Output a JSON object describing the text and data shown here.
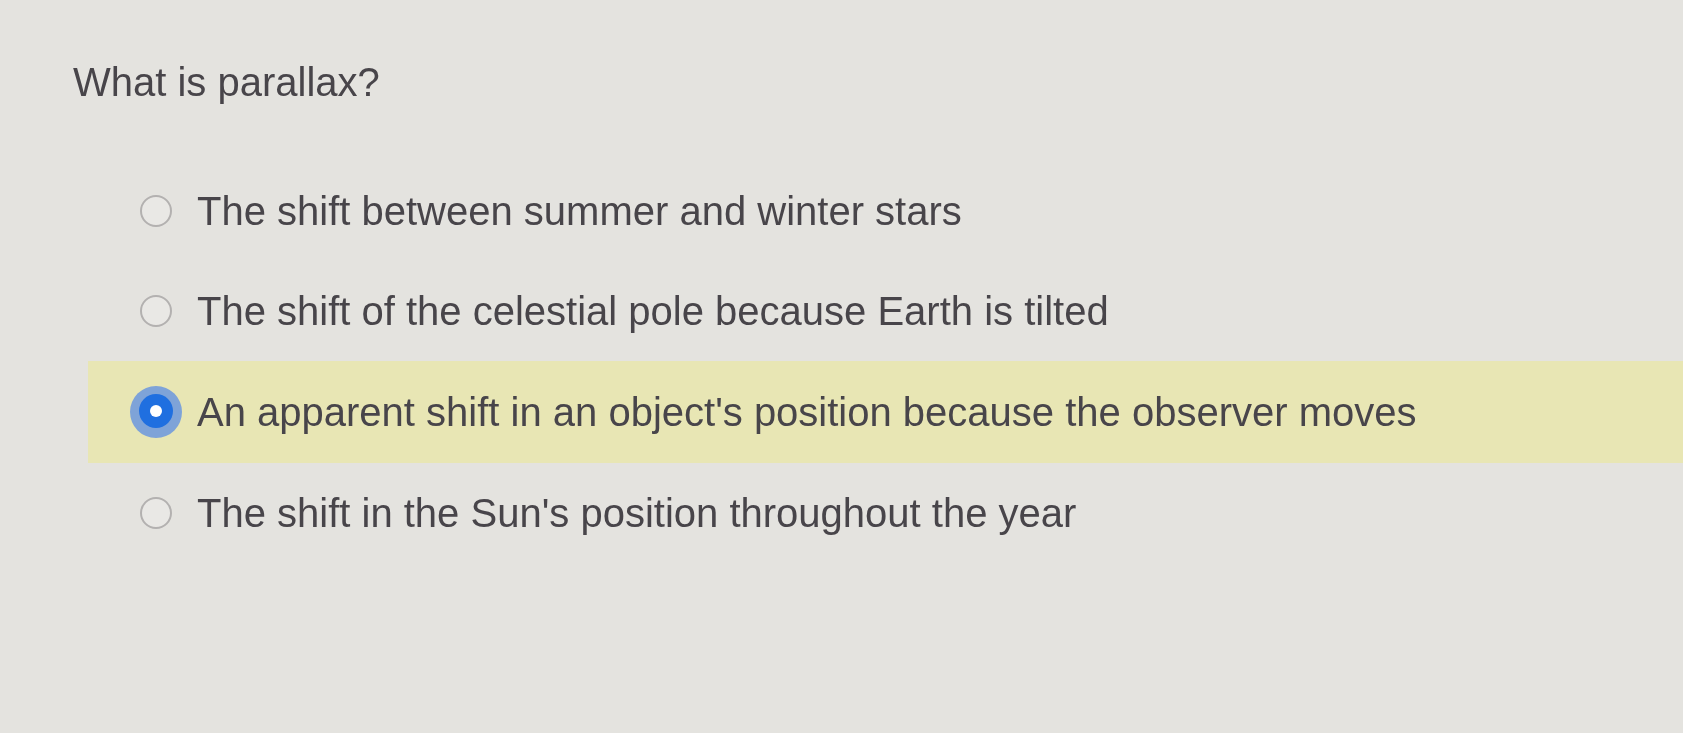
{
  "question": {
    "text": "What is parallax?"
  },
  "options": [
    {
      "label": "The shift between summer and winter stars",
      "selected": false
    },
    {
      "label": "The shift of the celestial pole because Earth is tilted",
      "selected": false
    },
    {
      "label": "An apparent shift in an object's position because the observer moves",
      "selected": true
    },
    {
      "label": "The shift in the Sun's position throughout the year",
      "selected": false
    }
  ]
}
